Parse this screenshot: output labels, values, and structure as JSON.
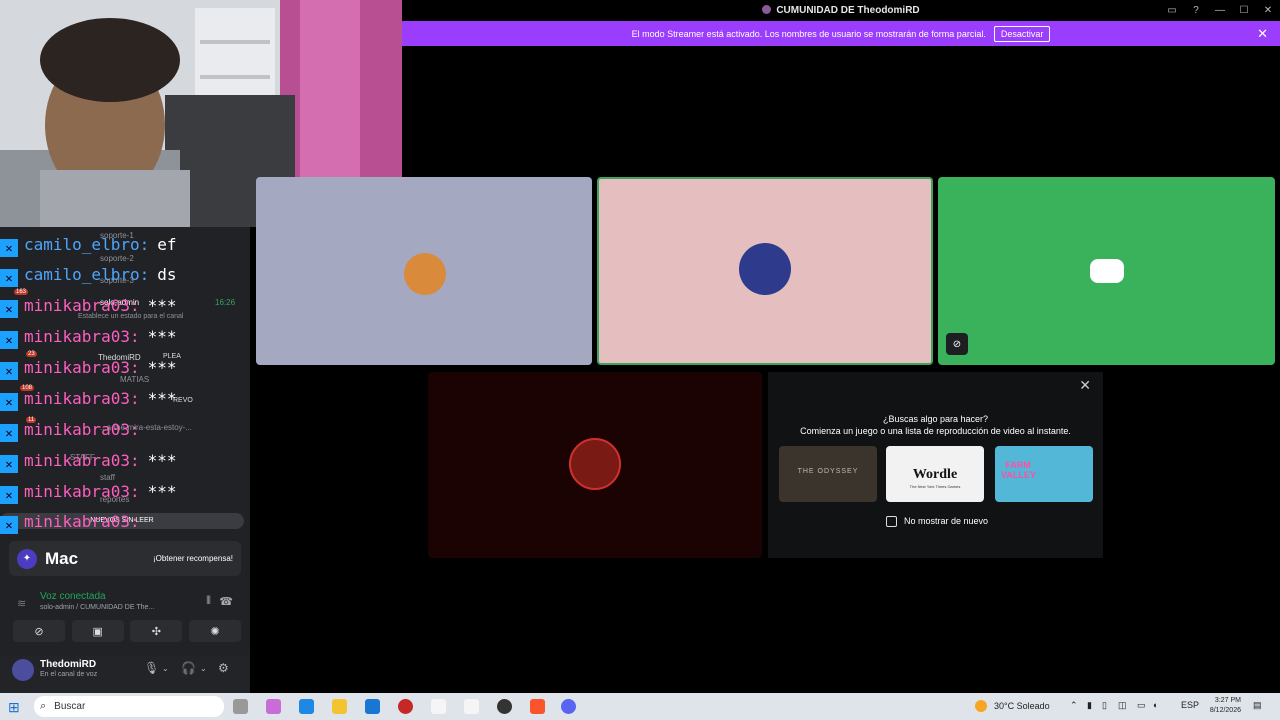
{
  "window": {
    "title": "CUMUNIDAD DE TheodomiRD"
  },
  "banner": {
    "text": "El modo Streamer está activado. Los nombres de usuario se mostrarán de forma parcial.",
    "button": "Desactivar",
    "close": "✕"
  },
  "sidebar": {
    "channels": {
      "soporte1": "soporte-1",
      "soporte2": "soporte-2",
      "soporte3": "soporte-3",
      "solo_admin": "solo-admin",
      "solo_admin_time": "16:26",
      "solo_admin_status": "Establece un estado para el canal",
      "voice_user1": "ThedomiRD",
      "voice_user1_tag": "PLEA",
      "voice_user2": "MATIAS",
      "revo": "REVO",
      "estoy": "...a-me-mira-esta-estoy-...",
      "staff_hdr": "STAFF",
      "staff": "staff",
      "reportes": "reportes",
      "unread": "NUEVOS SIN LEER"
    },
    "chat": [
      {
        "user": "camilo_elbro:",
        "msg": "ef"
      },
      {
        "user": "camilo_elbro:",
        "msg": "ds"
      },
      {
        "user": "minikabra03:",
        "msg": "***"
      },
      {
        "user": "minikabra03:",
        "msg": "***"
      },
      {
        "user": "minikabra03:",
        "msg": "***"
      },
      {
        "user": "minikabra03:",
        "msg": "***"
      },
      {
        "user": "minikabra03:",
        "msg": ""
      },
      {
        "user": "minikabra03:",
        "msg": "***"
      },
      {
        "user": "minikabra03:",
        "msg": "***"
      },
      {
        "user": "minikabra03:",
        "msg": ""
      }
    ],
    "badges": [
      "163",
      "23",
      "108",
      "11"
    ],
    "promo": {
      "brand": "Mac",
      "cta": "¡Obtener recompensa!"
    },
    "voice": {
      "status": "Voz conectada",
      "channel": "solo-admin / CUMUNIDAD DE The..."
    },
    "user": {
      "name": "ThedomiRD",
      "status": "En el canal de voz"
    }
  },
  "activity": {
    "heading": "¿Buscas algo para hacer?",
    "subheading": "Comienza un juego o una lista de reproducción de video al instante.",
    "cards": [
      "THE ODYSSEY",
      "Wordle",
      "FARM VALLEY"
    ],
    "wordle_sub": "The New York Times Games",
    "checkbox_label": "No mostrar de nuevo"
  },
  "taskbar": {
    "search": "Buscar",
    "weather": "30°C Soleado",
    "lang": "ESP",
    "time": "3:27 PM",
    "date": "8/12/2026"
  },
  "colors": {
    "accent": "#9b3dfd",
    "tile1": "#a4a8c1",
    "tile2": "#e5bfc0",
    "tile3": "#3ab25c",
    "tile4": "#1c0303",
    "green_border": "#3ba55d"
  },
  "icons": {
    "mic_muted": "mic-off-icon",
    "close": "close-icon",
    "discord": "discord-logo-icon"
  }
}
